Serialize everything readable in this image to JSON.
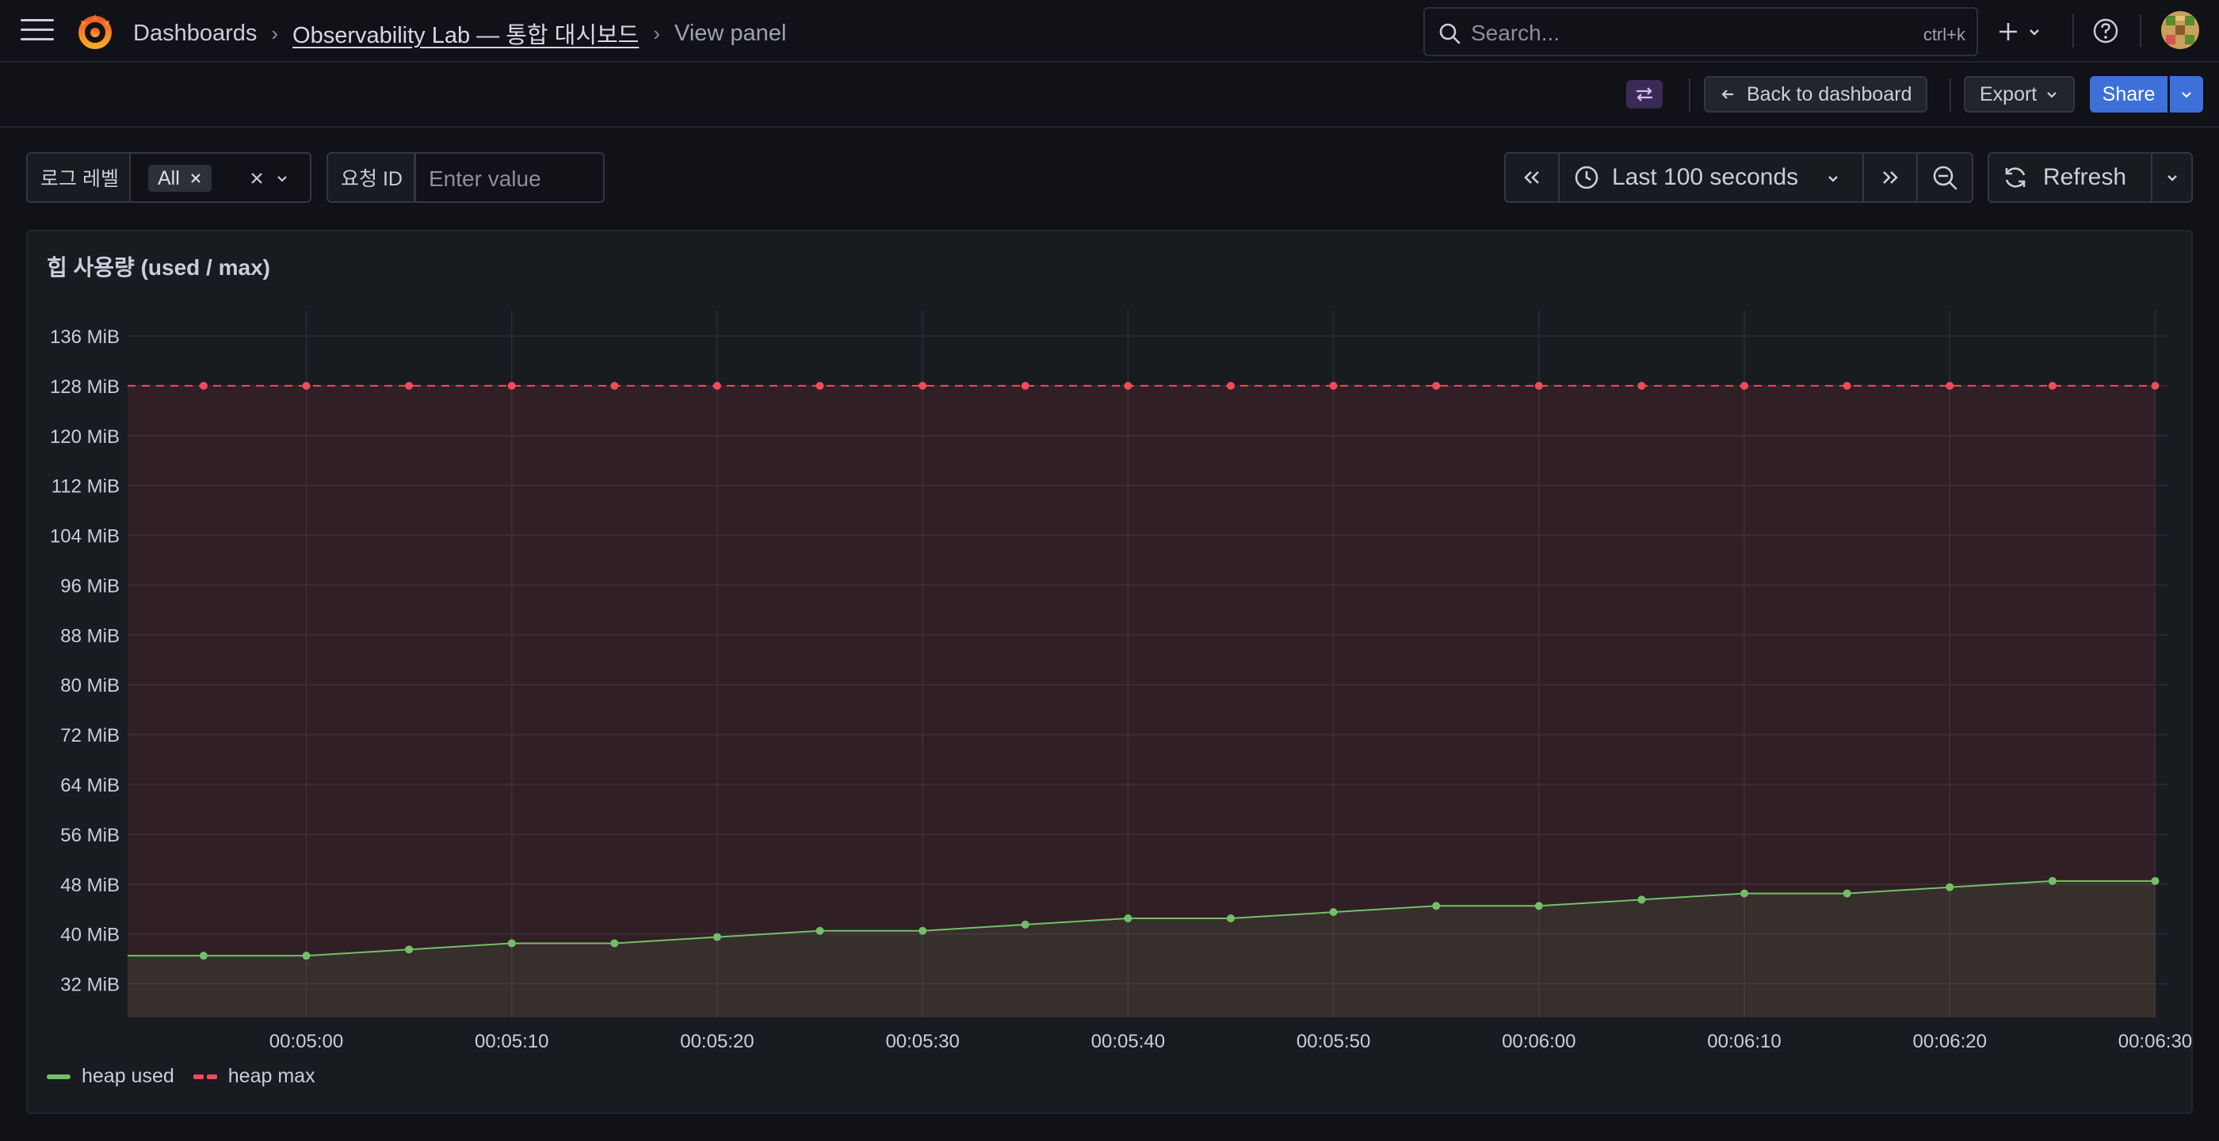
{
  "nav": {
    "breadcrumb": [
      "Dashboards",
      "Observability Lab — 통합 대시보드",
      "View panel"
    ],
    "search_placeholder": "Search...",
    "search_shortcut": "ctrl+k"
  },
  "toolbar": {
    "back_label": "Back to dashboard",
    "export_label": "Export",
    "share_label": "Share"
  },
  "variables": [
    {
      "label": "로그 레벨",
      "selected": "All"
    },
    {
      "label": "요청 ID",
      "placeholder": "Enter value"
    }
  ],
  "time": {
    "range_label": "Last 100 seconds",
    "refresh_label": "Refresh"
  },
  "panel": {
    "title": "힙 사용량 (used / max)"
  },
  "colors": {
    "used": "#73bf69",
    "max": "#f2495c",
    "accent": "#3d71d9"
  },
  "chart_data": {
    "type": "line",
    "title": "힙 사용량 (used / max)",
    "y_tick_labels": [
      "32 MiB",
      "40 MiB",
      "48 MiB",
      "56 MiB",
      "64 MiB",
      "72 MiB",
      "80 MiB",
      "88 MiB",
      "96 MiB",
      "104 MiB",
      "112 MiB",
      "120 MiB",
      "128 MiB",
      "136 MiB"
    ],
    "y_ticks": [
      32,
      40,
      48,
      56,
      64,
      72,
      80,
      88,
      96,
      104,
      112,
      120,
      128,
      136
    ],
    "ylim": [
      26.6,
      138.8
    ],
    "y_unit": "MiB",
    "x_tick_labels": [
      "00:05:00",
      "00:05:10",
      "00:05:20",
      "00:05:30",
      "00:05:40",
      "00:05:50",
      "00:06:00",
      "00:06:10",
      "00:06:20",
      "00:06:30"
    ],
    "x_ticks": [
      300,
      310,
      320,
      330,
      340,
      350,
      360,
      370,
      380,
      390
    ],
    "xlim": [
      291.3,
      390.6
    ],
    "grid": true,
    "legend_position": "bottom-left",
    "series": [
      {
        "name": "heap used",
        "style": "solid",
        "x_start": 291.3,
        "x": [
          295,
          300,
          305,
          310,
          315,
          320,
          325,
          330,
          335,
          340,
          345,
          350,
          355,
          360,
          365,
          370,
          375,
          380,
          385,
          390
        ],
        "values": [
          36.5,
          36.5,
          37.5,
          38.5,
          38.5,
          39.5,
          40.5,
          40.5,
          41.5,
          42.5,
          42.5,
          43.5,
          44.5,
          44.5,
          45.5,
          46.5,
          46.5,
          47.5,
          48.5,
          48.5
        ]
      },
      {
        "name": "heap max",
        "style": "dashed",
        "x": [
          295,
          300,
          305,
          310,
          315,
          320,
          325,
          330,
          335,
          340,
          345,
          350,
          355,
          360,
          365,
          370,
          375,
          380,
          385,
          390
        ],
        "values": [
          128,
          128,
          128,
          128,
          128,
          128,
          128,
          128,
          128,
          128,
          128,
          128,
          128,
          128,
          128,
          128,
          128,
          128,
          128,
          128
        ]
      }
    ]
  }
}
